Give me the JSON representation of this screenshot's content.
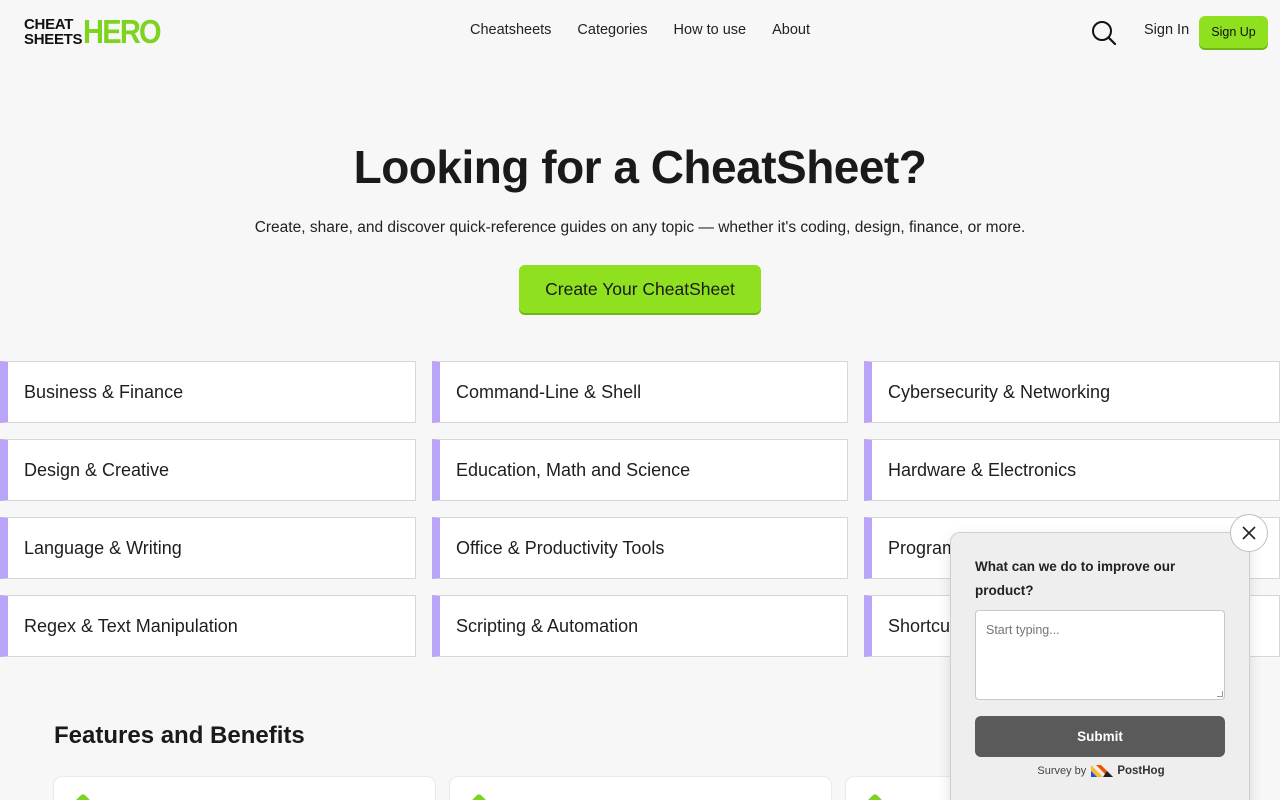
{
  "header": {
    "logo": {
      "line1": "CHEAT",
      "line2": "SHEETS",
      "hero": "HERO"
    },
    "nav": [
      "Cheatsheets",
      "Categories",
      "How to use",
      "About"
    ],
    "sign_in": "Sign In",
    "sign_up": "Sign Up"
  },
  "hero": {
    "title": "Looking for a CheatSheet?",
    "subtitle": "Create, share, and discover quick-reference guides on any topic — whether it's coding, design, finance, or more.",
    "cta": "Create Your CheatSheet"
  },
  "categories": [
    "Business & Finance",
    "Command-Line & Shell",
    "Cybersecurity & Networking",
    "Design & Creative",
    "Education, Math and Science",
    "Hardware & Electronics",
    "Language & Writing",
    "Office & Productivity Tools",
    "Program",
    "Regex & Text Manipulation",
    "Scripting & Automation",
    "Shortcu"
  ],
  "features": {
    "title": "Features and Benefits"
  },
  "survey": {
    "question": "What can we do to improve our product?",
    "placeholder": "Start typing...",
    "submit": "Submit",
    "footer_prefix": "Survey by",
    "brand": "PostHog"
  },
  "colors": {
    "accent_green": "#8fe01e",
    "category_bar": "#b9a4f7"
  }
}
